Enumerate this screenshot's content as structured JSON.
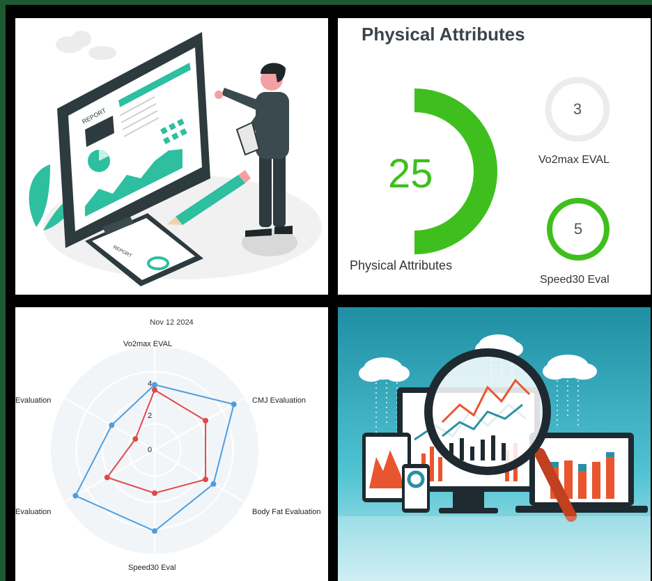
{
  "top_left": {
    "report_label_1": "REPORT",
    "report_label_2": "REPORT"
  },
  "top_right": {
    "title": "Physical Attributes",
    "main_value": "25",
    "main_label": "Physical Attributes",
    "vo2max_value": "3",
    "vo2max_label": "Vo2max EVAL",
    "speed_value": "5",
    "speed_label": "Speed30 Eval",
    "main_progress_fraction": 0.5,
    "vo2max_progress_fraction": 0,
    "speed_progress_fraction": 1,
    "colors": {
      "accent": "#3fbf1d",
      "track": "#ececec"
    }
  },
  "radar": {
    "date": "Nov 12 2024",
    "axes": [
      "Vo2max EVAL",
      "CMJ Evaluation",
      "Body Fat Evaluation",
      "Speed30 Eval",
      "Evaluation",
      "Evaluation"
    ],
    "tick_labels": [
      "4",
      "2",
      "0"
    ],
    "colors": {
      "blue": "#4d9ee0",
      "red": "#e0484a"
    }
  },
  "chart_data": {
    "type": "radar",
    "title": "Nov 12 2024",
    "categories": [
      "Vo2max EVAL",
      "CMJ Evaluation",
      "Body Fat Evaluation",
      "Speed30 Eval",
      "Evaluation",
      "Evaluation"
    ],
    "range": [
      -2,
      6
    ],
    "ticks": [
      0,
      2,
      4
    ],
    "series": [
      {
        "values": [
          3,
          5,
          3.2,
          4.2,
          5,
          1.8
        ]
      },
      {
        "values": [
          2.6,
          2.5,
          2.5,
          1.3,
          2.2,
          -0.3
        ]
      }
    ]
  }
}
